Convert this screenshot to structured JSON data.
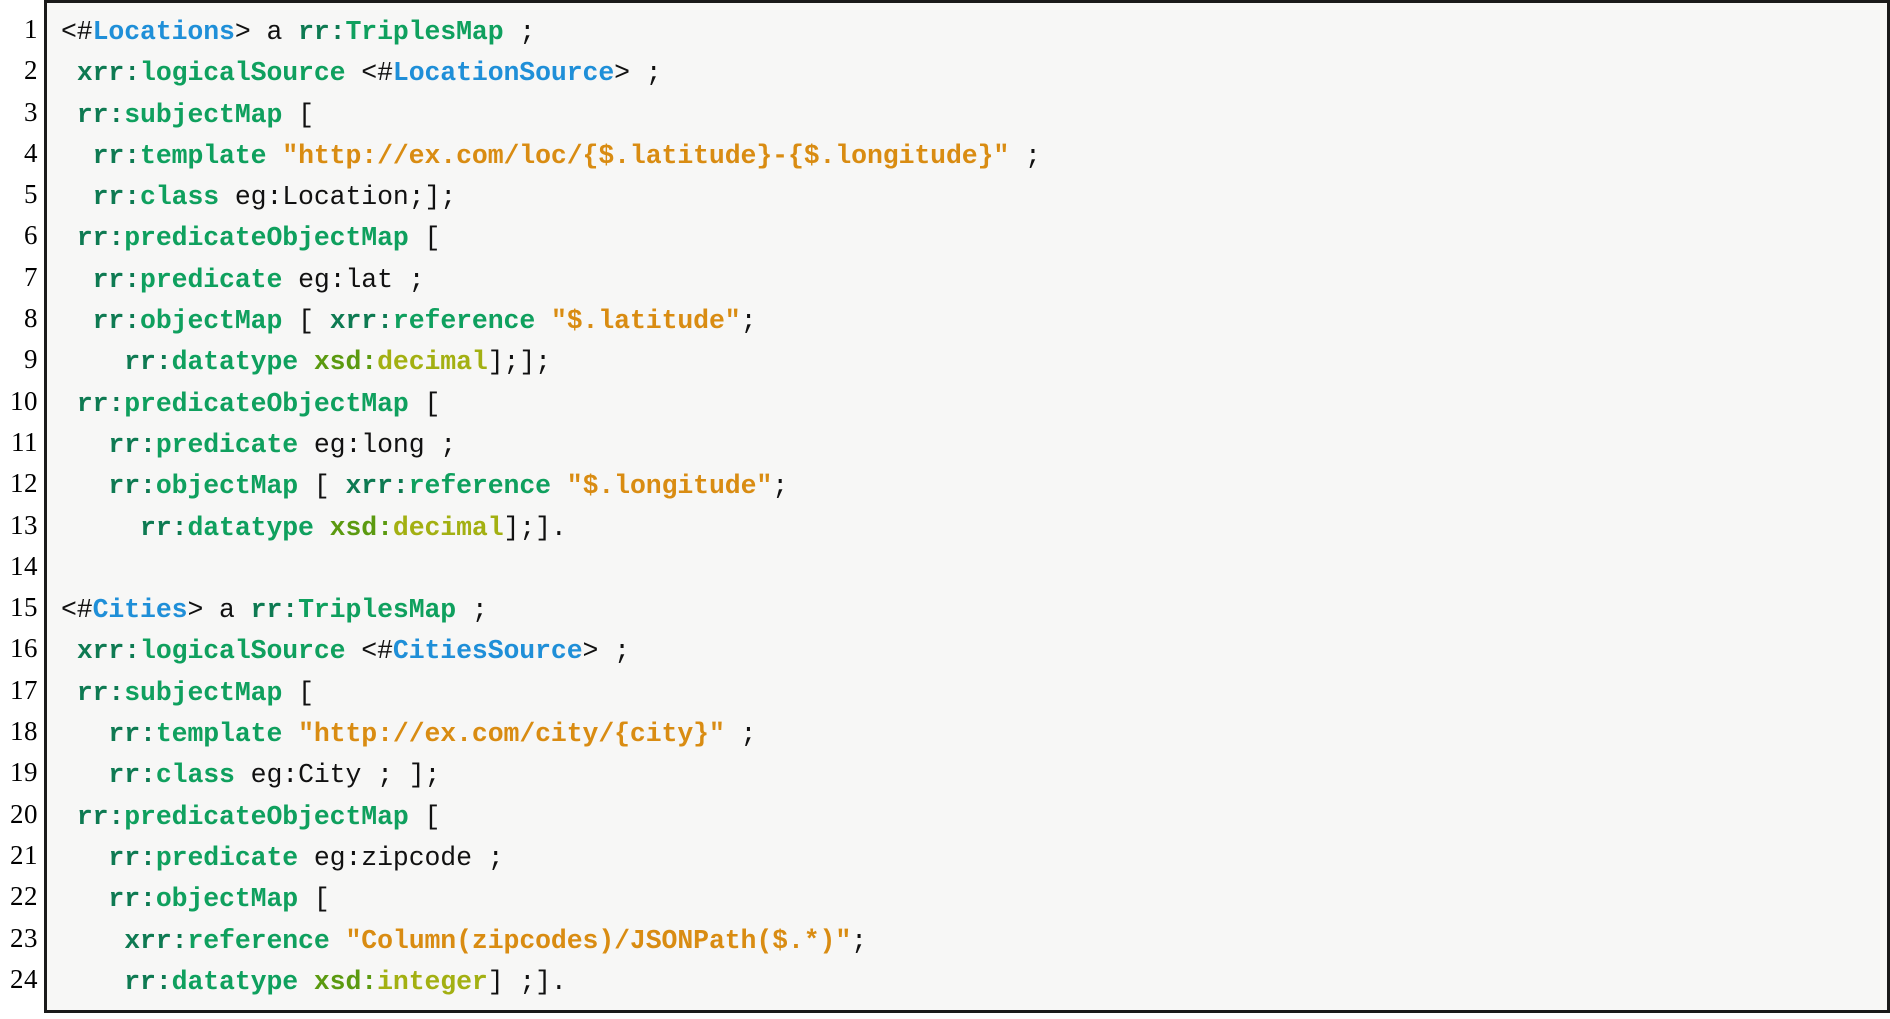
{
  "listing": {
    "language": "turtle",
    "kind": "code-listing",
    "colors": {
      "background": "#f7f7f6",
      "border": "#1a1a1a",
      "plain": "#111111",
      "prefix": "#0e7a52",
      "local_name": "#0fa05e",
      "iri": "#1f8fd8",
      "string": "#d98c12",
      "datatype_prefix": "#5b9a10",
      "datatype_name": "#a3b012"
    },
    "line_numbers": [
      "1",
      "2",
      "3",
      "4",
      "5",
      "6",
      "7",
      "8",
      "9",
      "10",
      "11",
      "12",
      "13",
      "14",
      "15",
      "16",
      "17",
      "18",
      "19",
      "20",
      "21",
      "22",
      "23",
      "24"
    ],
    "lines": [
      {
        "n": "1",
        "text": "<#Locations> a rr:TriplesMap ;",
        "tokens": [
          {
            "t": "<#",
            "c": "plain"
          },
          {
            "t": "Locations",
            "c": "iri"
          },
          {
            "t": "> a ",
            "c": "plain"
          },
          {
            "t": "rr:",
            "c": "pfx"
          },
          {
            "t": "TriplesMap",
            "c": "name"
          },
          {
            "t": " ;",
            "c": "plain"
          }
        ]
      },
      {
        "n": "2",
        "text": " xrr:logicalSource <#LocationSource> ;",
        "tokens": [
          {
            "t": " ",
            "c": "plain"
          },
          {
            "t": "xrr:",
            "c": "pfx"
          },
          {
            "t": "logicalSource",
            "c": "name"
          },
          {
            "t": " <#",
            "c": "plain"
          },
          {
            "t": "LocationSource",
            "c": "iri"
          },
          {
            "t": "> ;",
            "c": "plain"
          }
        ]
      },
      {
        "n": "3",
        "text": " rr:subjectMap [",
        "tokens": [
          {
            "t": " ",
            "c": "plain"
          },
          {
            "t": "rr:",
            "c": "pfx"
          },
          {
            "t": "subjectMap",
            "c": "name"
          },
          {
            "t": " [",
            "c": "plain"
          }
        ]
      },
      {
        "n": "4",
        "text": "  rr:template \"http://ex.com/loc/{$.latitude}-{$.longitude}\" ;",
        "tokens": [
          {
            "t": "  ",
            "c": "plain"
          },
          {
            "t": "rr:",
            "c": "pfx"
          },
          {
            "t": "template",
            "c": "name"
          },
          {
            "t": " ",
            "c": "plain"
          },
          {
            "t": "\"http://ex.com/loc/{$.latitude}-{$.longitude}\"",
            "c": "str"
          },
          {
            "t": " ;",
            "c": "plain"
          }
        ]
      },
      {
        "n": "5",
        "text": "  rr:class eg:Location;];",
        "tokens": [
          {
            "t": "  ",
            "c": "plain"
          },
          {
            "t": "rr:",
            "c": "pfx"
          },
          {
            "t": "class",
            "c": "name"
          },
          {
            "t": " eg:Location;];",
            "c": "plain"
          }
        ]
      },
      {
        "n": "6",
        "text": " rr:predicateObjectMap [",
        "tokens": [
          {
            "t": " ",
            "c": "plain"
          },
          {
            "t": "rr:",
            "c": "pfx"
          },
          {
            "t": "predicateObjectMap",
            "c": "name"
          },
          {
            "t": " [",
            "c": "plain"
          }
        ]
      },
      {
        "n": "7",
        "text": "  rr:predicate eg:lat ;",
        "tokens": [
          {
            "t": "  ",
            "c": "plain"
          },
          {
            "t": "rr:",
            "c": "pfx"
          },
          {
            "t": "predicate",
            "c": "name"
          },
          {
            "t": " eg:lat ;",
            "c": "plain"
          }
        ]
      },
      {
        "n": "8",
        "text": "  rr:objectMap [ xrr:reference \"$.latitude\";",
        "tokens": [
          {
            "t": "  ",
            "c": "plain"
          },
          {
            "t": "rr:",
            "c": "pfx"
          },
          {
            "t": "objectMap",
            "c": "name"
          },
          {
            "t": " [ ",
            "c": "plain"
          },
          {
            "t": "xrr:",
            "c": "pfx"
          },
          {
            "t": "reference",
            "c": "name"
          },
          {
            "t": " ",
            "c": "plain"
          },
          {
            "t": "\"$.latitude\"",
            "c": "str"
          },
          {
            "t": ";",
            "c": "plain"
          }
        ]
      },
      {
        "n": "9",
        "text": "    rr:datatype xsd:decimal];];",
        "tokens": [
          {
            "t": "    ",
            "c": "plain"
          },
          {
            "t": "rr:",
            "c": "pfx"
          },
          {
            "t": "datatype",
            "c": "name"
          },
          {
            "t": " ",
            "c": "plain"
          },
          {
            "t": "xsd:",
            "c": "dtpfx"
          },
          {
            "t": "decimal",
            "c": "dt"
          },
          {
            "t": "];];",
            "c": "plain"
          }
        ]
      },
      {
        "n": "10",
        "text": " rr:predicateObjectMap [",
        "tokens": [
          {
            "t": " ",
            "c": "plain"
          },
          {
            "t": "rr:",
            "c": "pfx"
          },
          {
            "t": "predicateObjectMap",
            "c": "name"
          },
          {
            "t": " [",
            "c": "plain"
          }
        ]
      },
      {
        "n": "11",
        "text": "   rr:predicate eg:long ;",
        "tokens": [
          {
            "t": "   ",
            "c": "plain"
          },
          {
            "t": "rr:",
            "c": "pfx"
          },
          {
            "t": "predicate",
            "c": "name"
          },
          {
            "t": " eg:long ;",
            "c": "plain"
          }
        ]
      },
      {
        "n": "12",
        "text": "   rr:objectMap [ xrr:reference \"$.longitude\";",
        "tokens": [
          {
            "t": "   ",
            "c": "plain"
          },
          {
            "t": "rr:",
            "c": "pfx"
          },
          {
            "t": "objectMap",
            "c": "name"
          },
          {
            "t": " [ ",
            "c": "plain"
          },
          {
            "t": "xrr:",
            "c": "pfx"
          },
          {
            "t": "reference",
            "c": "name"
          },
          {
            "t": " ",
            "c": "plain"
          },
          {
            "t": "\"$.longitude\"",
            "c": "str"
          },
          {
            "t": ";",
            "c": "plain"
          }
        ]
      },
      {
        "n": "13",
        "text": "     rr:datatype xsd:decimal];].",
        "tokens": [
          {
            "t": "     ",
            "c": "plain"
          },
          {
            "t": "rr:",
            "c": "pfx"
          },
          {
            "t": "datatype",
            "c": "name"
          },
          {
            "t": " ",
            "c": "plain"
          },
          {
            "t": "xsd:",
            "c": "dtpfx"
          },
          {
            "t": "decimal",
            "c": "dt"
          },
          {
            "t": "];].",
            "c": "plain"
          }
        ]
      },
      {
        "n": "14",
        "text": "",
        "tokens": []
      },
      {
        "n": "15",
        "text": "<#Cities> a rr:TriplesMap ;",
        "tokens": [
          {
            "t": "<#",
            "c": "plain"
          },
          {
            "t": "Cities",
            "c": "iri"
          },
          {
            "t": "> a ",
            "c": "plain"
          },
          {
            "t": "rr:",
            "c": "pfx"
          },
          {
            "t": "TriplesMap",
            "c": "name"
          },
          {
            "t": " ;",
            "c": "plain"
          }
        ]
      },
      {
        "n": "16",
        "text": " xrr:logicalSource <#CitiesSource> ;",
        "tokens": [
          {
            "t": " ",
            "c": "plain"
          },
          {
            "t": "xrr:",
            "c": "pfx"
          },
          {
            "t": "logicalSource",
            "c": "name"
          },
          {
            "t": " <#",
            "c": "plain"
          },
          {
            "t": "CitiesSource",
            "c": "iri"
          },
          {
            "t": "> ;",
            "c": "plain"
          }
        ]
      },
      {
        "n": "17",
        "text": " rr:subjectMap [",
        "tokens": [
          {
            "t": " ",
            "c": "plain"
          },
          {
            "t": "rr:",
            "c": "pfx"
          },
          {
            "t": "subjectMap",
            "c": "name"
          },
          {
            "t": " [",
            "c": "plain"
          }
        ]
      },
      {
        "n": "18",
        "text": "   rr:template \"http://ex.com/city/{city}\" ;",
        "tokens": [
          {
            "t": "   ",
            "c": "plain"
          },
          {
            "t": "rr:",
            "c": "pfx"
          },
          {
            "t": "template",
            "c": "name"
          },
          {
            "t": " ",
            "c": "plain"
          },
          {
            "t": "\"http://ex.com/city/{city}\"",
            "c": "str"
          },
          {
            "t": " ;",
            "c": "plain"
          }
        ]
      },
      {
        "n": "19",
        "text": "   rr:class eg:City ; ];",
        "tokens": [
          {
            "t": "   ",
            "c": "plain"
          },
          {
            "t": "rr:",
            "c": "pfx"
          },
          {
            "t": "class",
            "c": "name"
          },
          {
            "t": " eg:City ; ];",
            "c": "plain"
          }
        ]
      },
      {
        "n": "20",
        "text": " rr:predicateObjectMap [",
        "tokens": [
          {
            "t": " ",
            "c": "plain"
          },
          {
            "t": "rr:",
            "c": "pfx"
          },
          {
            "t": "predicateObjectMap",
            "c": "name"
          },
          {
            "t": " [",
            "c": "plain"
          }
        ]
      },
      {
        "n": "21",
        "text": "   rr:predicate eg:zipcode ;",
        "tokens": [
          {
            "t": "   ",
            "c": "plain"
          },
          {
            "t": "rr:",
            "c": "pfx"
          },
          {
            "t": "predicate",
            "c": "name"
          },
          {
            "t": " eg:zipcode ;",
            "c": "plain"
          }
        ]
      },
      {
        "n": "22",
        "text": "   rr:objectMap [",
        "tokens": [
          {
            "t": "   ",
            "c": "plain"
          },
          {
            "t": "rr:",
            "c": "pfx"
          },
          {
            "t": "objectMap",
            "c": "name"
          },
          {
            "t": " [",
            "c": "plain"
          }
        ]
      },
      {
        "n": "23",
        "text": "    xrr:reference \"Column(zipcodes)/JSONPath($.*)\";",
        "tokens": [
          {
            "t": "    ",
            "c": "plain"
          },
          {
            "t": "xrr:",
            "c": "pfx"
          },
          {
            "t": "reference",
            "c": "name"
          },
          {
            "t": " ",
            "c": "plain"
          },
          {
            "t": "\"Column(zipcodes)/JSONPath($.*)\"",
            "c": "str"
          },
          {
            "t": ";",
            "c": "plain"
          }
        ]
      },
      {
        "n": "24",
        "text": "    rr:datatype xsd:integer] ;].",
        "tokens": [
          {
            "t": "    ",
            "c": "plain"
          },
          {
            "t": "rr:",
            "c": "pfx"
          },
          {
            "t": "datatype",
            "c": "name"
          },
          {
            "t": " ",
            "c": "plain"
          },
          {
            "t": "xsd:",
            "c": "dtpfx"
          },
          {
            "t": "integer",
            "c": "dt"
          },
          {
            "t": "] ;].",
            "c": "plain"
          }
        ]
      }
    ]
  }
}
